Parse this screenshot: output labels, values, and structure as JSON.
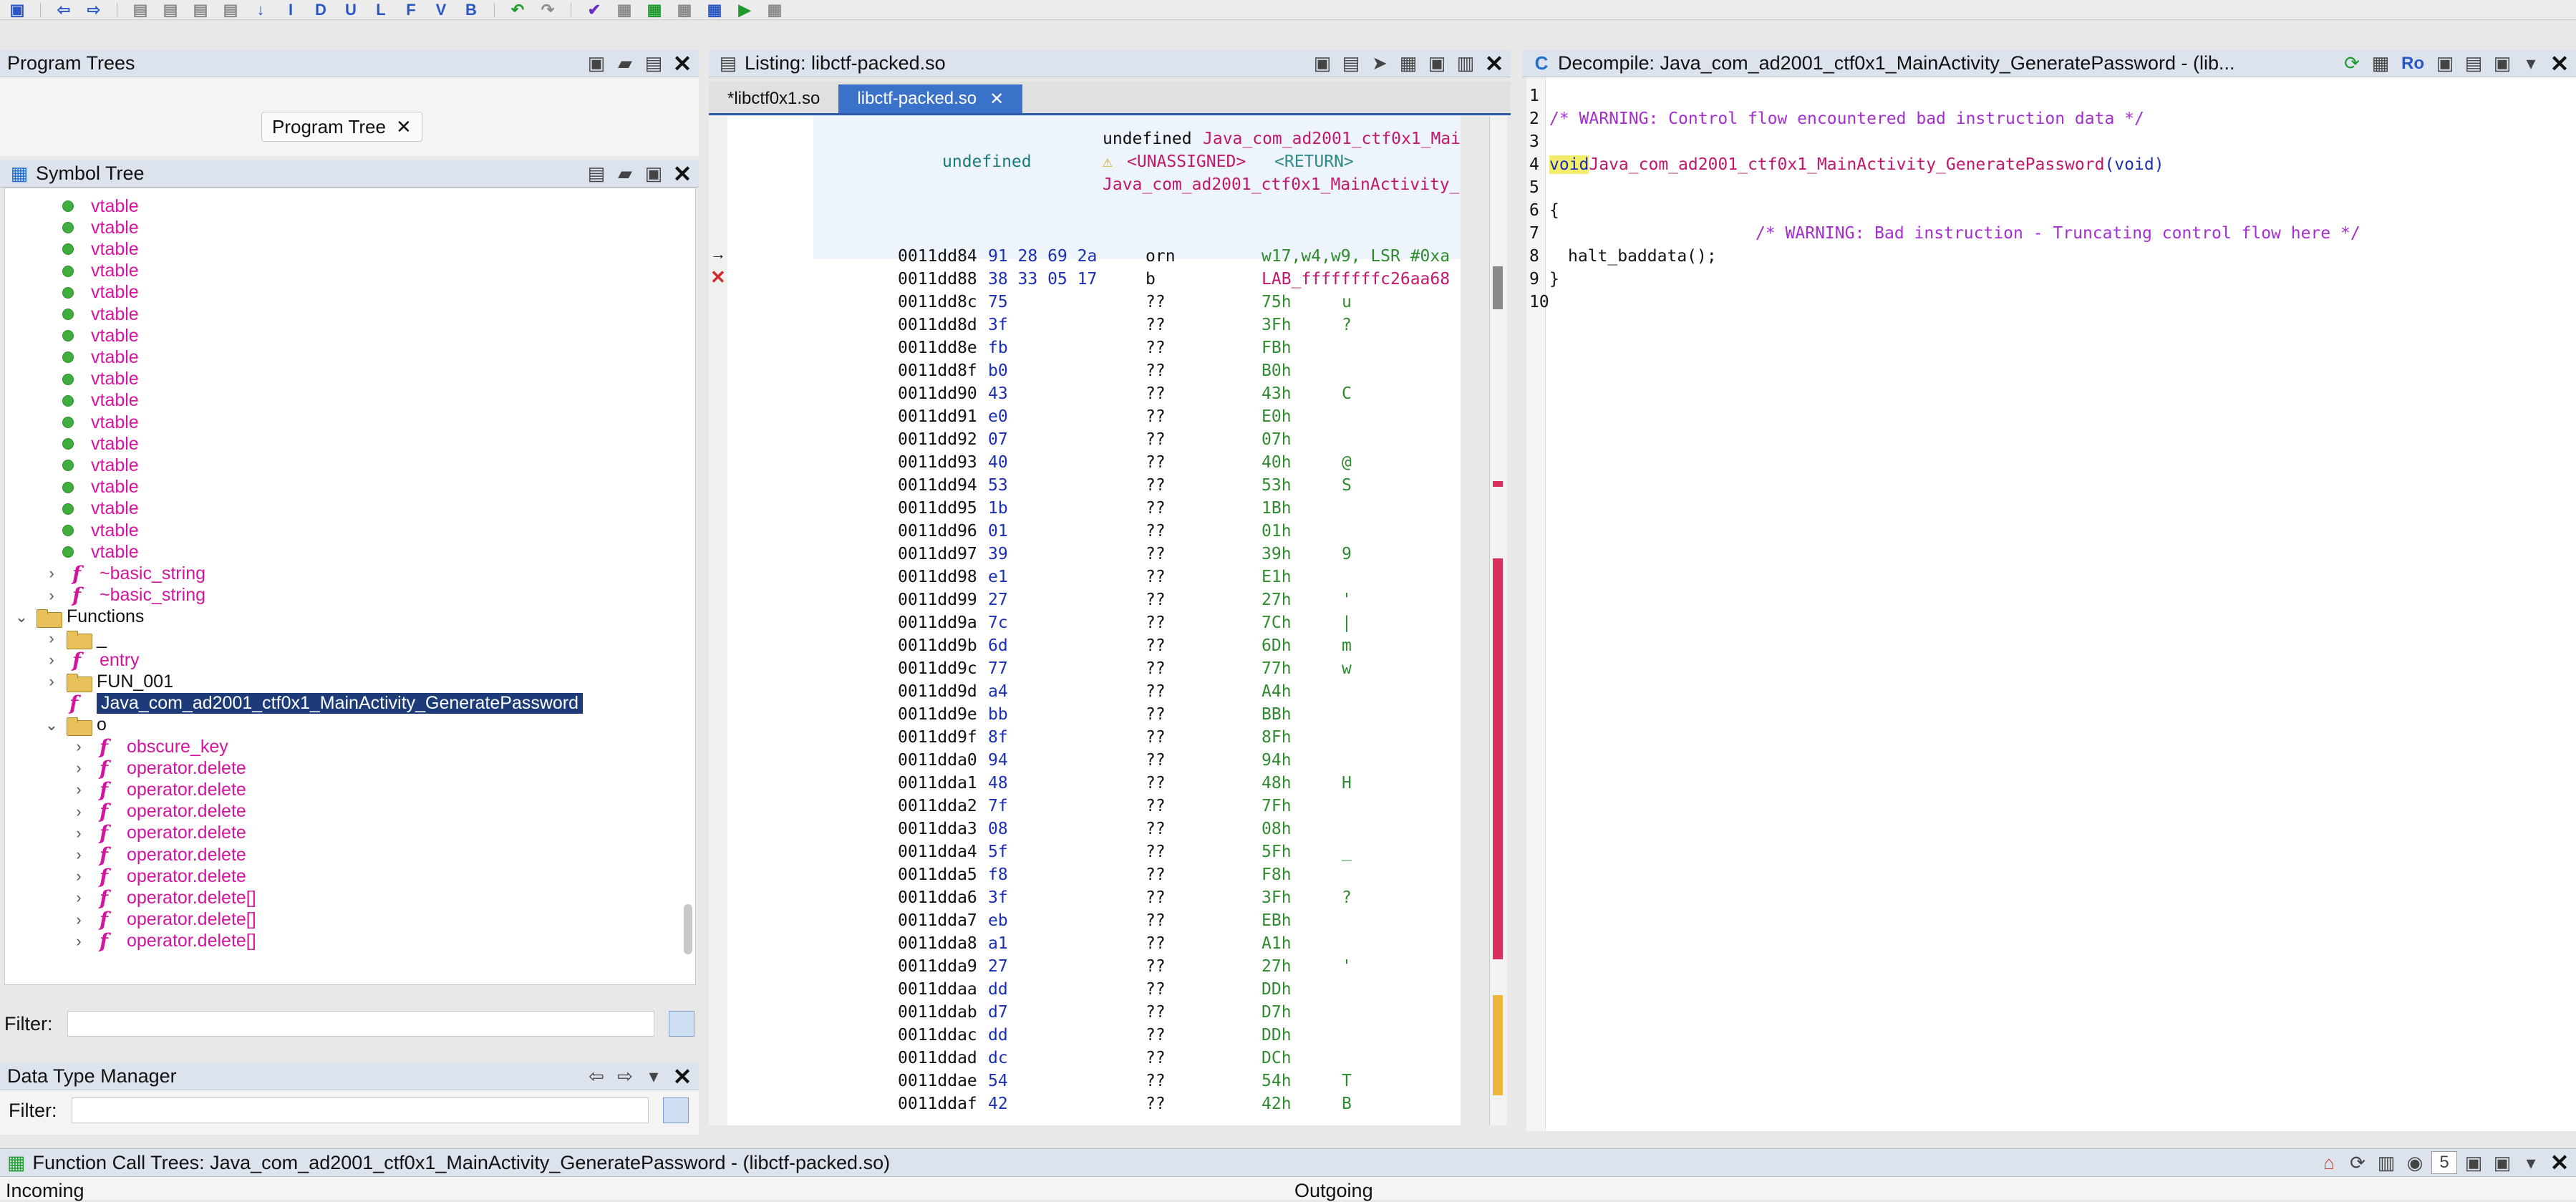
{
  "program_trees": {
    "title": "Program Trees",
    "tab_label": "Program Tree"
  },
  "symbol_tree": {
    "title": "Symbol Tree",
    "vtable_label": "vtable",
    "items": [
      {
        "kind": "dot",
        "label": "vtable"
      },
      {
        "kind": "dot",
        "label": "vtable"
      },
      {
        "kind": "dot",
        "label": "vtable"
      },
      {
        "kind": "dot",
        "label": "vtable"
      },
      {
        "kind": "dot",
        "label": "vtable"
      },
      {
        "kind": "dot",
        "label": "vtable"
      },
      {
        "kind": "dot",
        "label": "vtable"
      },
      {
        "kind": "dot",
        "label": "vtable"
      },
      {
        "kind": "dot",
        "label": "vtable"
      },
      {
        "kind": "dot",
        "label": "vtable"
      },
      {
        "kind": "dot",
        "label": "vtable"
      },
      {
        "kind": "dot",
        "label": "vtable"
      },
      {
        "kind": "dot",
        "label": "vtable"
      },
      {
        "kind": "dot",
        "label": "vtable"
      },
      {
        "kind": "dot",
        "label": "vtable"
      },
      {
        "kind": "dot",
        "label": "vtable"
      },
      {
        "kind": "dot",
        "label": "vtable"
      },
      {
        "kind": "fn",
        "label": "~basic_string"
      },
      {
        "kind": "fn",
        "label": "~basic_string"
      },
      {
        "kind": "folder-open",
        "label": "Functions"
      },
      {
        "kind": "folder",
        "label": "_"
      },
      {
        "kind": "fn",
        "label": "entry"
      },
      {
        "kind": "folder",
        "label": "FUN_001"
      },
      {
        "kind": "fn-selected",
        "label": "Java_com_ad2001_ctf0x1_MainActivity_GeneratePassword"
      },
      {
        "kind": "folder-open",
        "label": "o"
      },
      {
        "kind": "fn2",
        "label": "obscure_key"
      },
      {
        "kind": "fn2",
        "label": "operator.delete"
      },
      {
        "kind": "fn2",
        "label": "operator.delete"
      },
      {
        "kind": "fn2",
        "label": "operator.delete"
      },
      {
        "kind": "fn2",
        "label": "operator.delete"
      },
      {
        "kind": "fn2",
        "label": "operator.delete"
      },
      {
        "kind": "fn2",
        "label": "operator.delete"
      },
      {
        "kind": "fn2",
        "label": "operator.delete[]"
      },
      {
        "kind": "fn2",
        "label": "operator.delete[]"
      },
      {
        "kind": "fn2",
        "label": "operator.delete[]"
      }
    ],
    "filter_label": "Filter:"
  },
  "listing": {
    "title": "Listing:  libctf-packed.so",
    "tabs": [
      "*libctf0x1.so",
      "libctf-packed.so"
    ],
    "header": {
      "type": "undefined",
      "signature_type": "undefined",
      "signature_name": "Java_com_ad2001_ctf0x1_Mai",
      "unassigned": "<UNASSIGNED>",
      "return": "<RETURN>",
      "label": "Java_com_ad2001_ctf0x1_MainActivity_"
    },
    "rows": [
      {
        "addr": "0011dd84",
        "bytes": "91 28 69 2a",
        "mnem": "orn",
        "oper": "w17,w4,w9, LSR #0xa",
        "chr": ""
      },
      {
        "addr": "0011dd88",
        "bytes": "38 33 05 17",
        "mnem": "b",
        "oper": "LAB_ffffffffc26aa68",
        "chr": ""
      },
      {
        "addr": "0011dd8c",
        "bytes": "75",
        "mnem": "??",
        "oper": "75h",
        "chr": "u"
      },
      {
        "addr": "0011dd8d",
        "bytes": "3f",
        "mnem": "??",
        "oper": "3Fh",
        "chr": "?"
      },
      {
        "addr": "0011dd8e",
        "bytes": "fb",
        "mnem": "??",
        "oper": "FBh",
        "chr": ""
      },
      {
        "addr": "0011dd8f",
        "bytes": "b0",
        "mnem": "??",
        "oper": "B0h",
        "chr": ""
      },
      {
        "addr": "0011dd90",
        "bytes": "43",
        "mnem": "??",
        "oper": "43h",
        "chr": "C"
      },
      {
        "addr": "0011dd91",
        "bytes": "e0",
        "mnem": "??",
        "oper": "E0h",
        "chr": ""
      },
      {
        "addr": "0011dd92",
        "bytes": "07",
        "mnem": "??",
        "oper": "07h",
        "chr": ""
      },
      {
        "addr": "0011dd93",
        "bytes": "40",
        "mnem": "??",
        "oper": "40h",
        "chr": "@"
      },
      {
        "addr": "0011dd94",
        "bytes": "53",
        "mnem": "??",
        "oper": "53h",
        "chr": "S"
      },
      {
        "addr": "0011dd95",
        "bytes": "1b",
        "mnem": "??",
        "oper": "1Bh",
        "chr": ""
      },
      {
        "addr": "0011dd96",
        "bytes": "01",
        "mnem": "??",
        "oper": "01h",
        "chr": ""
      },
      {
        "addr": "0011dd97",
        "bytes": "39",
        "mnem": "??",
        "oper": "39h",
        "chr": "9"
      },
      {
        "addr": "0011dd98",
        "bytes": "e1",
        "mnem": "??",
        "oper": "E1h",
        "chr": ""
      },
      {
        "addr": "0011dd99",
        "bytes": "27",
        "mnem": "??",
        "oper": "27h",
        "chr": "'"
      },
      {
        "addr": "0011dd9a",
        "bytes": "7c",
        "mnem": "??",
        "oper": "7Ch",
        "chr": "|"
      },
      {
        "addr": "0011dd9b",
        "bytes": "6d",
        "mnem": "??",
        "oper": "6Dh",
        "chr": "m"
      },
      {
        "addr": "0011dd9c",
        "bytes": "77",
        "mnem": "??",
        "oper": "77h",
        "chr": "w"
      },
      {
        "addr": "0011dd9d",
        "bytes": "a4",
        "mnem": "??",
        "oper": "A4h",
        "chr": ""
      },
      {
        "addr": "0011dd9e",
        "bytes": "bb",
        "mnem": "??",
        "oper": "BBh",
        "chr": ""
      },
      {
        "addr": "0011dd9f",
        "bytes": "8f",
        "mnem": "??",
        "oper": "8Fh",
        "chr": ""
      },
      {
        "addr": "0011dda0",
        "bytes": "94",
        "mnem": "??",
        "oper": "94h",
        "chr": ""
      },
      {
        "addr": "0011dda1",
        "bytes": "48",
        "mnem": "??",
        "oper": "48h",
        "chr": "H"
      },
      {
        "addr": "0011dda2",
        "bytes": "7f",
        "mnem": "??",
        "oper": "7Fh",
        "chr": ""
      },
      {
        "addr": "0011dda3",
        "bytes": "08",
        "mnem": "??",
        "oper": "08h",
        "chr": ""
      },
      {
        "addr": "0011dda4",
        "bytes": "5f",
        "mnem": "??",
        "oper": "5Fh",
        "chr": "_"
      },
      {
        "addr": "0011dda5",
        "bytes": "f8",
        "mnem": "??",
        "oper": "F8h",
        "chr": ""
      },
      {
        "addr": "0011dda6",
        "bytes": "3f",
        "mnem": "??",
        "oper": "3Fh",
        "chr": "?"
      },
      {
        "addr": "0011dda7",
        "bytes": "eb",
        "mnem": "??",
        "oper": "EBh",
        "chr": ""
      },
      {
        "addr": "0011dda8",
        "bytes": "a1",
        "mnem": "??",
        "oper": "A1h",
        "chr": ""
      },
      {
        "addr": "0011dda9",
        "bytes": "27",
        "mnem": "??",
        "oper": "27h",
        "chr": "'"
      },
      {
        "addr": "0011ddaa",
        "bytes": "dd",
        "mnem": "??",
        "oper": "DDh",
        "chr": ""
      },
      {
        "addr": "0011ddab",
        "bytes": "d7",
        "mnem": "??",
        "oper": "D7h",
        "chr": ""
      },
      {
        "addr": "0011ddac",
        "bytes": "dd",
        "mnem": "??",
        "oper": "DDh",
        "chr": ""
      },
      {
        "addr": "0011ddad",
        "bytes": "dc",
        "mnem": "??",
        "oper": "DCh",
        "chr": ""
      },
      {
        "addr": "0011ddae",
        "bytes": "54",
        "mnem": "??",
        "oper": "54h",
        "chr": "T"
      },
      {
        "addr": "0011ddaf",
        "bytes": "42",
        "mnem": "??",
        "oper": "42h",
        "chr": "B"
      }
    ]
  },
  "decompile": {
    "title": "Decompile: Java_com_ad2001_ctf0x1_MainActivity_GeneratePassword -  (lib...",
    "ro_label": "Ro",
    "lines": [
      "1",
      "2",
      "3",
      "4",
      "5",
      "6",
      "7",
      "8",
      "9",
      "10"
    ],
    "code": {
      "l2": "/* WARNING: Control flow encountered bad instruction data */",
      "l4_kw": "void",
      "l4_fn": "Java_com_ad2001_ctf0x1_MainActivity_GeneratePassword",
      "l4_args": "(void)",
      "l6": "{",
      "l7": "/* WARNING: Bad instruction - Truncating control flow here */",
      "l8_fn": "halt_baddata",
      "l8_rest": "();",
      "l9": "}"
    }
  },
  "data_type_manager": {
    "title": "Data Type Manager",
    "filter_label": "Filter:"
  },
  "function_call_trees": {
    "title": "Function Call Trees: Java_com_ad2001_ctf0x1_MainActivity_GeneratePassword -  (libctf-packed.so)",
    "incoming": "Incoming",
    "outgoing": "Outgoing",
    "depth": "5"
  }
}
